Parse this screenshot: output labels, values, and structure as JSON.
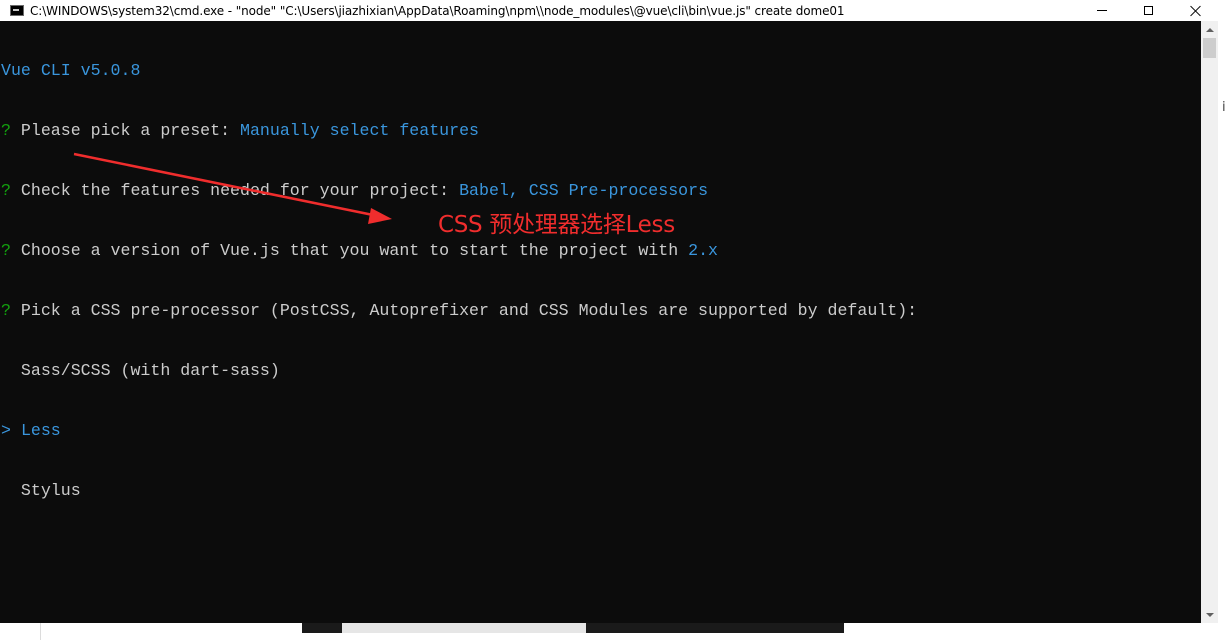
{
  "window": {
    "title": "C:\\WINDOWS\\system32\\cmd.exe  - \"node\"   \"C:\\Users\\jiazhixian\\AppData\\Roaming\\npm\\\\node_modules\\@vue\\cli\\bin\\vue.js\" create dome01",
    "icon": "cmd-icon",
    "buttons": {
      "minimize": "minimize-icon",
      "maximize": "maximize-icon",
      "close": "close-icon"
    }
  },
  "console": {
    "header": "Vue CLI v5.0.8",
    "prompt_symbol": "?",
    "questions": [
      {
        "text": " Please pick a preset: ",
        "answer": "Manually select features"
      },
      {
        "text": " Check the features needed for your project: ",
        "answer": "Babel, CSS Pre-processors"
      },
      {
        "text": " Choose a version of Vue.js that you want to start the project with ",
        "answer": "2.x"
      },
      {
        "text": " Pick a CSS pre-processor (PostCSS, Autoprefixer and CSS Modules are supported by default):",
        "answer": ""
      }
    ],
    "options": [
      {
        "label": "Sass/SCSS (with dart-sass)",
        "selected": false
      },
      {
        "label": "Less",
        "selected": true
      },
      {
        "label": "Stylus",
        "selected": false
      }
    ],
    "cursor_symbol": ">"
  },
  "annotation": {
    "text": "CSS 预处理器选择Less",
    "color": "#f02d2d"
  },
  "side_text": "i",
  "colors": {
    "background": "#0c0c0c",
    "text": "#cccccc",
    "accent_blue": "#3a96dd",
    "prompt_green": "#13a10e"
  }
}
